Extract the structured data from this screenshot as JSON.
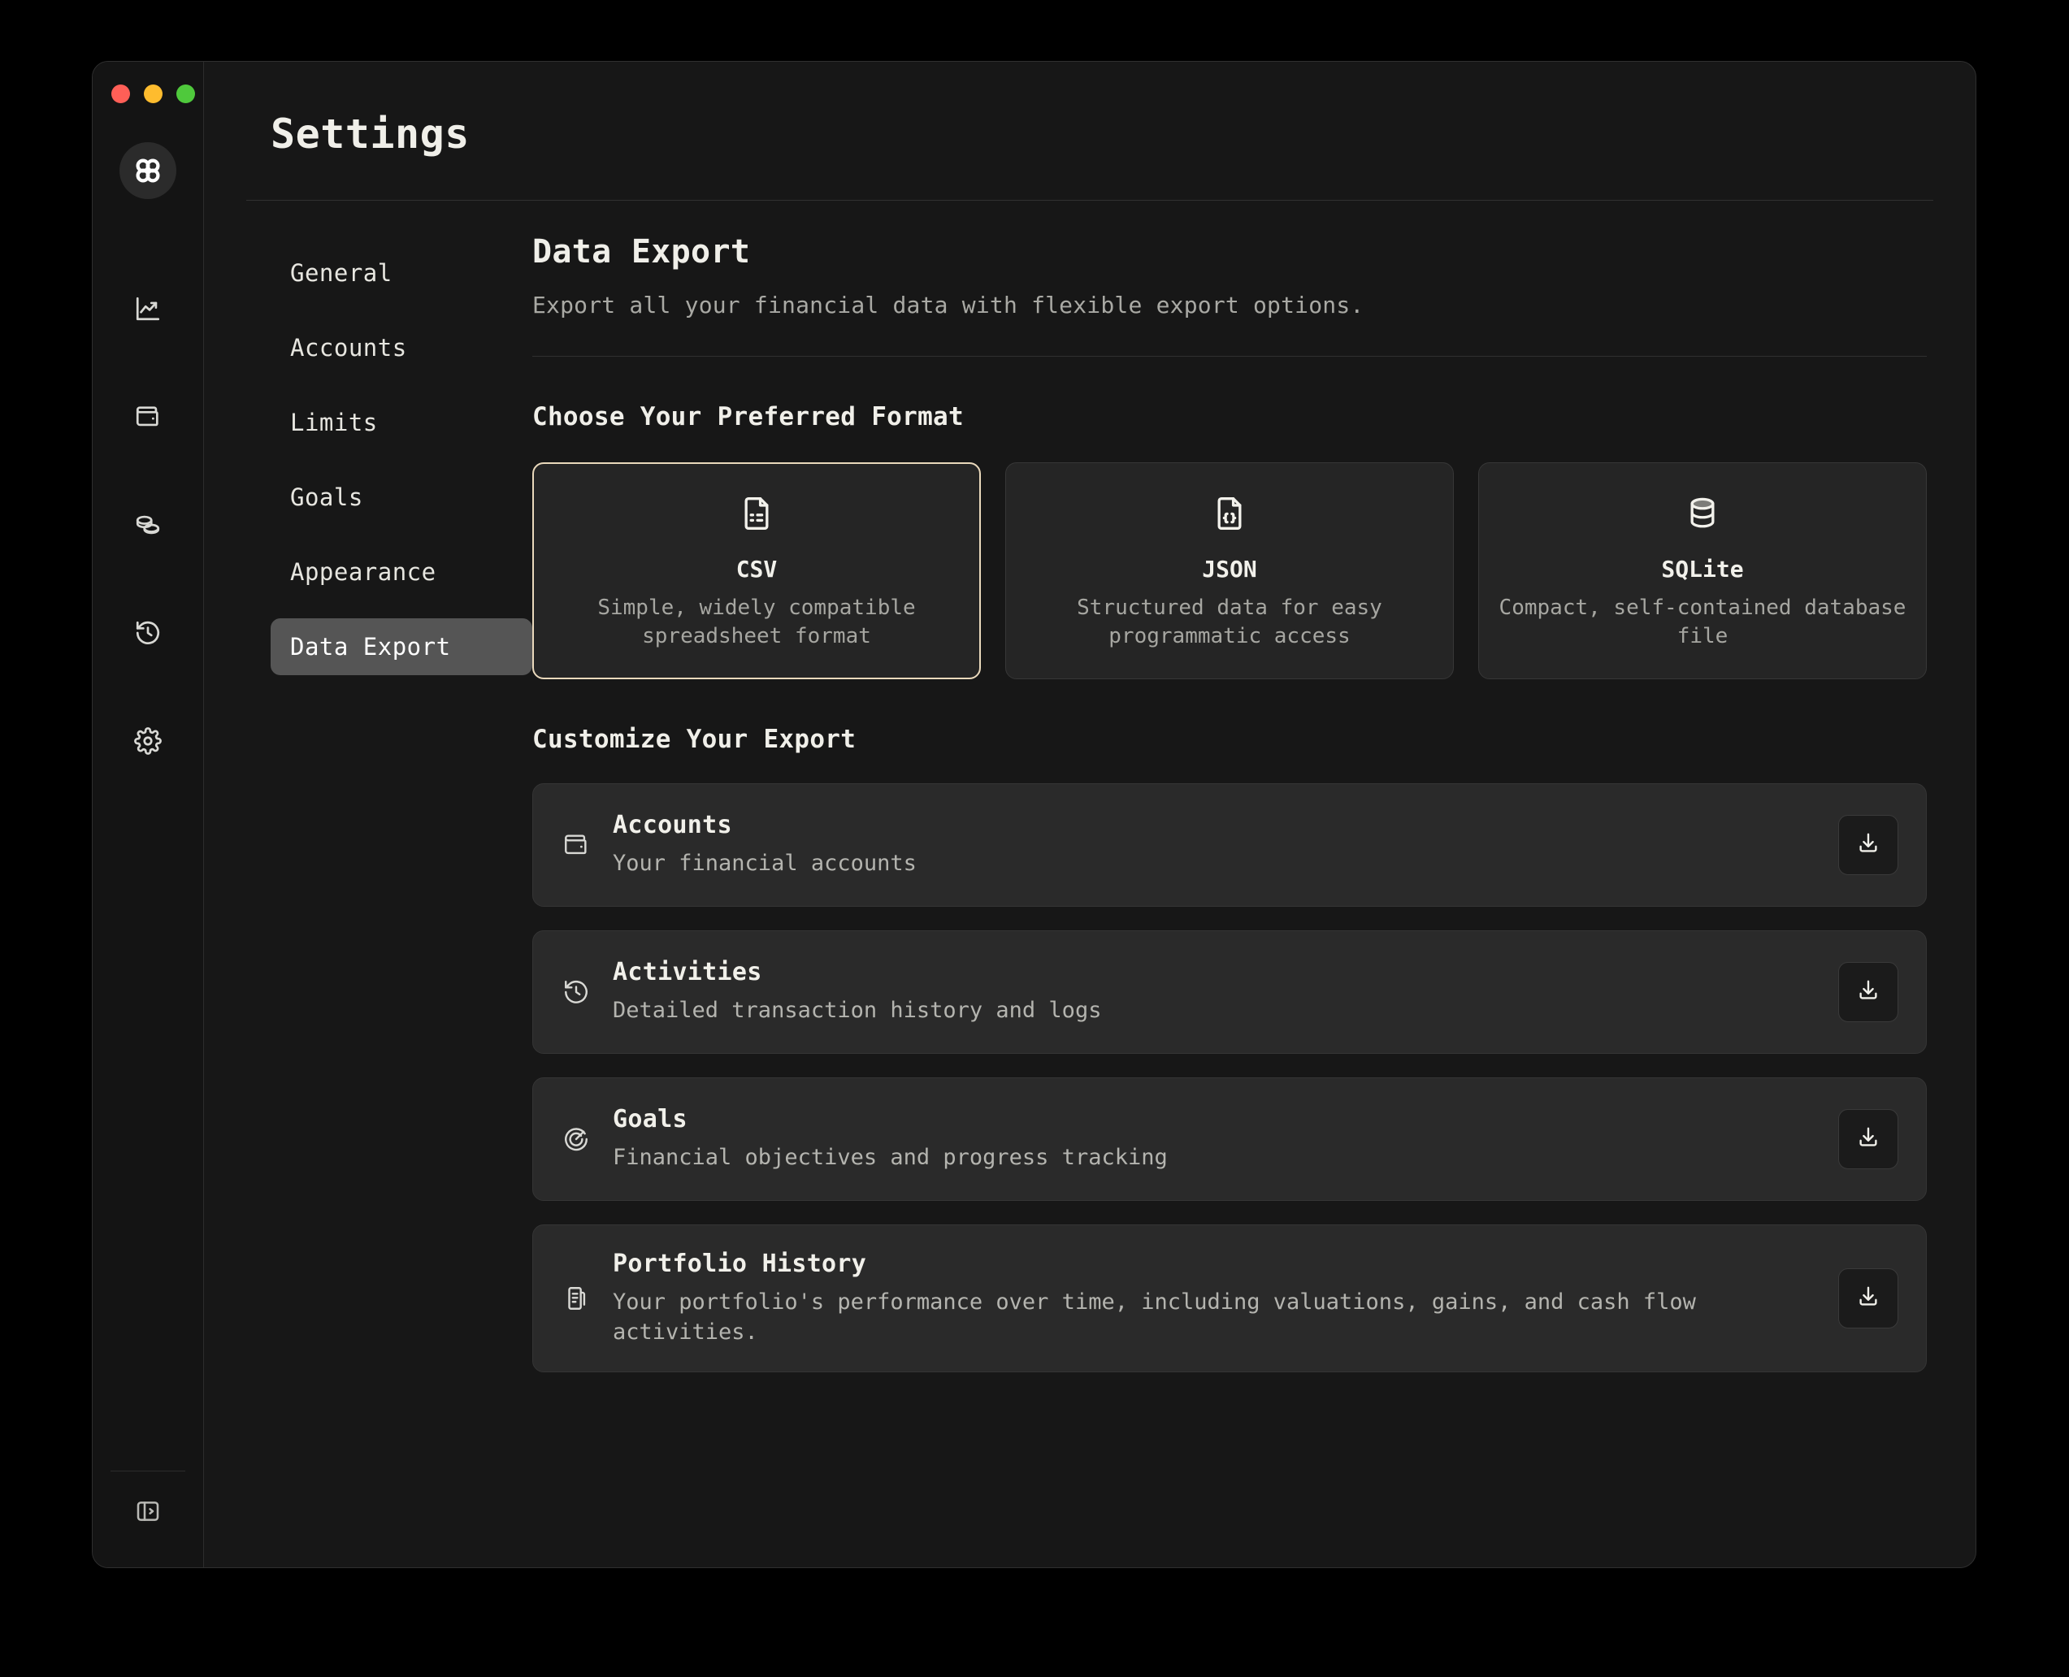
{
  "window": {
    "traffic_lights": [
      "close",
      "minimize",
      "zoom"
    ],
    "logo": "app-logo-rings"
  },
  "rail": {
    "items": [
      {
        "name": "dashboard",
        "icon": "chart-line-up-icon"
      },
      {
        "name": "accounts",
        "icon": "wallet-icon"
      },
      {
        "name": "holdings",
        "icon": "coins-icon"
      },
      {
        "name": "activity",
        "icon": "history-clock-icon"
      },
      {
        "name": "settings",
        "icon": "gear-icon"
      }
    ],
    "toggle": {
      "name": "sidebar-toggle",
      "icon": "panel-expand-icon"
    }
  },
  "header": {
    "title": "Settings"
  },
  "settings_nav": {
    "items": [
      {
        "label": "General",
        "active": false
      },
      {
        "label": "Accounts",
        "active": false
      },
      {
        "label": "Limits",
        "active": false
      },
      {
        "label": "Goals",
        "active": false
      },
      {
        "label": "Appearance",
        "active": false
      },
      {
        "label": "Data Export",
        "active": true
      }
    ]
  },
  "page": {
    "title": "Data Export",
    "subtitle": "Export all your financial data with flexible export options."
  },
  "format_section": {
    "heading": "Choose Your Preferred Format",
    "options": [
      {
        "name": "CSV",
        "description": "Simple, widely compatible spreadsheet format",
        "icon": "file-spreadsheet-icon",
        "selected": true
      },
      {
        "name": "JSON",
        "description": "Structured data for easy programmatic access",
        "icon": "file-json-icon",
        "selected": false
      },
      {
        "name": "SQLite",
        "description": "Compact, self-contained database file",
        "icon": "database-icon",
        "selected": false
      }
    ]
  },
  "customize_section": {
    "heading": "Customize Your Export",
    "rows": [
      {
        "name": "Accounts",
        "description": "Your financial accounts",
        "icon": "wallet-icon",
        "action": "download"
      },
      {
        "name": "Activities",
        "description": "Detailed transaction history and logs",
        "icon": "history-clock-icon",
        "action": "download"
      },
      {
        "name": "Goals",
        "description": "Financial objectives and progress tracking",
        "icon": "target-icon",
        "action": "download"
      },
      {
        "name": "Portfolio History",
        "description": "Your portfolio's performance over time, including valuations, gains, and cash flow activities.",
        "icon": "scroll-text-icon",
        "action": "download"
      }
    ]
  },
  "colors": {
    "page_background": "#171717",
    "window_background": "#141414",
    "card_background": "#252525",
    "row_background": "#2a2a2a",
    "accent_selected_border": "#ead9bc",
    "nav_active_background": "#555555",
    "text_primary": "#f0efe9",
    "text_muted": "#a9a9a4",
    "traffic_red": "#ff5f57",
    "traffic_yellow": "#febc2e",
    "traffic_green": "#4fc93c"
  }
}
